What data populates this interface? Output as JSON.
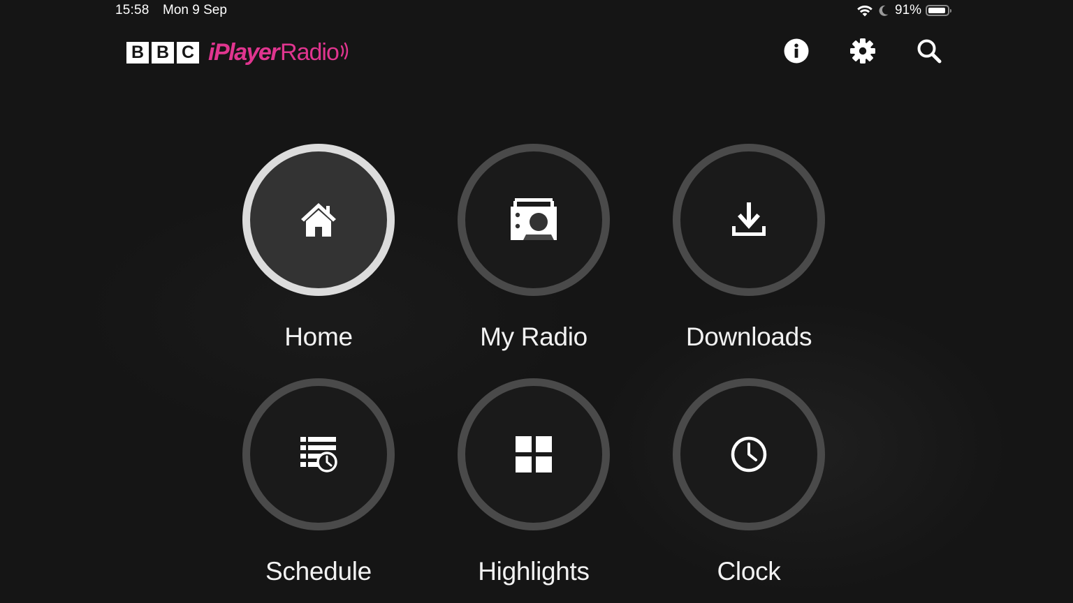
{
  "status_bar": {
    "time": "15:58",
    "date": "Mon 9 Sep",
    "battery_percent": "91%",
    "battery_level": 0.91,
    "icons": [
      "wifi-icon",
      "moon-icon",
      "battery-icon"
    ]
  },
  "header": {
    "logo": {
      "bbc_letters": [
        "B",
        "B",
        "C"
      ],
      "iplayer_text": "iPlayer",
      "radio_text": "Radio"
    },
    "buttons": [
      "info-icon",
      "gear-icon",
      "search-icon"
    ]
  },
  "colors": {
    "brand_pink": "#e0358f",
    "background": "#151515",
    "ring": "#4a4a4a",
    "ring_selected": "#dcdcdc"
  },
  "nav": {
    "items": [
      {
        "label": "Home",
        "icon": "home-icon",
        "selected": true
      },
      {
        "label": "My Radio",
        "icon": "radio-icon",
        "selected": false
      },
      {
        "label": "Downloads",
        "icon": "download-icon",
        "selected": false
      },
      {
        "label": "Schedule",
        "icon": "schedule-icon",
        "selected": false
      },
      {
        "label": "Highlights",
        "icon": "grid-icon",
        "selected": false
      },
      {
        "label": "Clock",
        "icon": "clock-icon",
        "selected": false
      }
    ]
  }
}
